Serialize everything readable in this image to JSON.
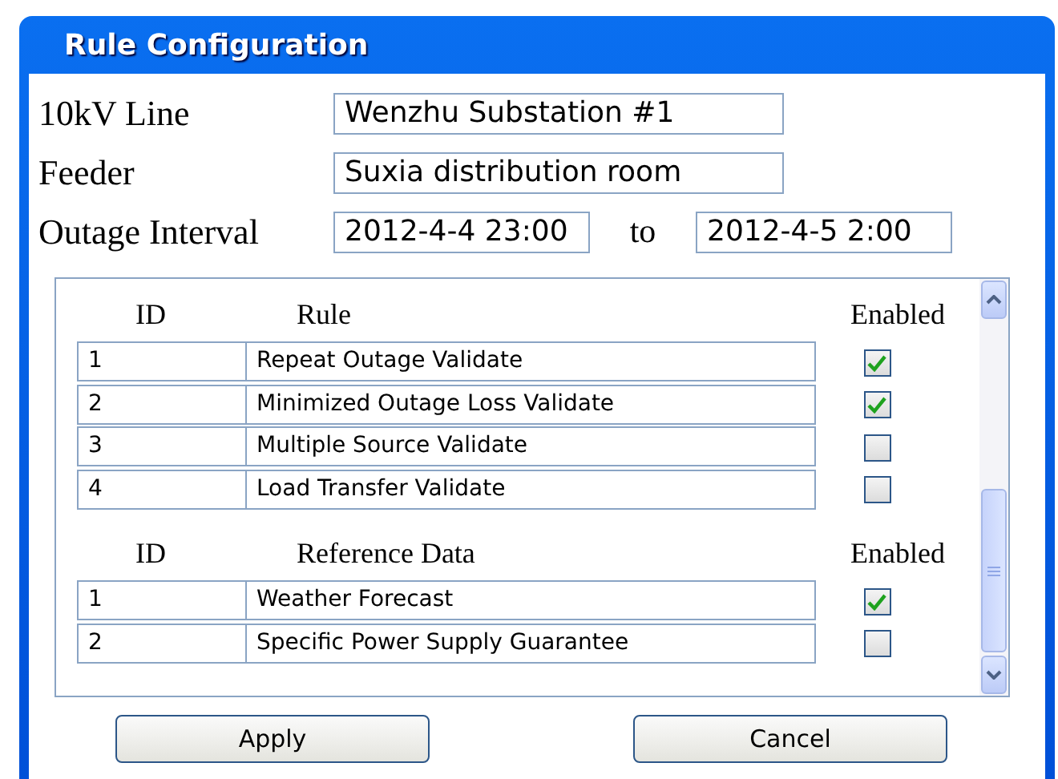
{
  "window": {
    "title": "Rule Configuration"
  },
  "form": {
    "line": {
      "label": "10kV Line",
      "value": "Wenzhu Substation #1"
    },
    "feeder": {
      "label": "Feeder",
      "value": "Suxia distribution room"
    },
    "interval": {
      "label": "Outage Interval",
      "from": "2012-4-4 23:00",
      "separator": "to",
      "to": "2012-4-5 2:00"
    }
  },
  "sections": [
    {
      "columns": [
        "ID",
        "Rule",
        "Enabled"
      ],
      "rows": [
        {
          "id": "1",
          "name": "Repeat Outage Validate",
          "checked": true
        },
        {
          "id": "2",
          "name": "Minimized Outage Loss Validate",
          "checked": true
        },
        {
          "id": "3",
          "name": "Multiple Source Validate",
          "checked": false
        },
        {
          "id": "4",
          "name": "Load Transfer Validate",
          "checked": false
        }
      ]
    },
    {
      "columns": [
        "ID",
        "Reference Data",
        "Enabled"
      ],
      "rows": [
        {
          "id": "1",
          "name": "Weather Forecast",
          "checked": true
        },
        {
          "id": "2",
          "name": "Specific Power Supply Guarantee",
          "checked": false
        }
      ]
    }
  ],
  "buttons": [
    "Apply",
    "Cancel"
  ]
}
